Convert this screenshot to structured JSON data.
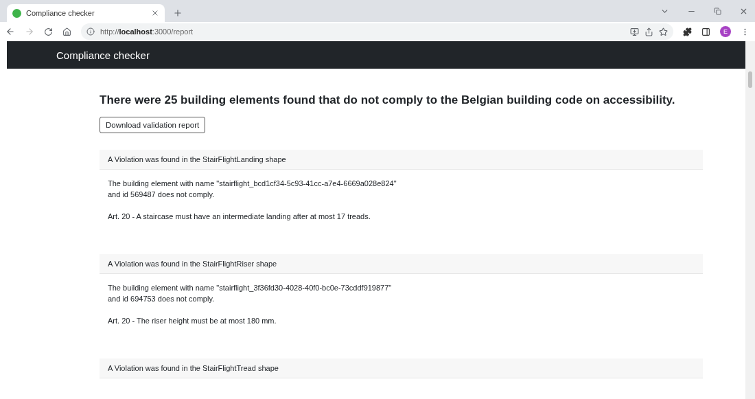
{
  "browser": {
    "tab_title": "Compliance checker",
    "url_prefix": "http://",
    "url_host": "localhost",
    "url_rest": ":3000/report",
    "profile_initial": "E"
  },
  "navbar": {
    "brand": "Compliance checker"
  },
  "heading": "There were 25 building elements found that do not comply to the Belgian building code on accessibility.",
  "download_button": "Download validation report",
  "violations": [
    {
      "header": "A Violation was found in the StairFlightLanding shape",
      "element_line": "The building element with name \"stairflight_bcd1cf34-5c93-41cc-a7e4-6669a028e824\"",
      "id_line": "and id 569487 does not comply.",
      "rule": "Art. 20 - A staircase must have an intermediate landing after at most 17 treads."
    },
    {
      "header": "A Violation was found in the StairFlightRiser shape",
      "element_line": "The building element with name \"stairflight_3f36fd30-4028-40f0-bc0e-73cddf919877\"",
      "id_line": "and id 694753 does not comply.",
      "rule": "Art. 20 - The riser height must be at most 180 mm."
    },
    {
      "header": "A Violation was found in the StairFlightTread shape"
    }
  ]
}
